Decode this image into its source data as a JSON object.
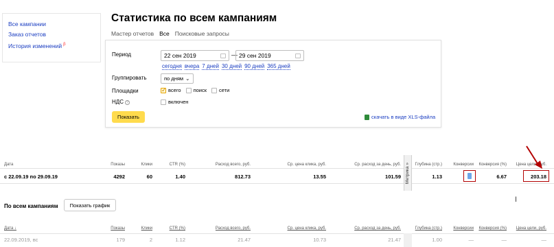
{
  "sidebar": {
    "items": [
      {
        "label": "Все кампании"
      },
      {
        "label": "Заказ отчетов"
      },
      {
        "label": "История изменений",
        "badge": "β"
      }
    ]
  },
  "page": {
    "title": "Статистика по всем кампаниям",
    "tabs": [
      {
        "label": "Мастер отчетов",
        "active": false
      },
      {
        "label": "Все",
        "active": true
      },
      {
        "label": "Поисковые запросы",
        "active": false
      }
    ]
  },
  "filters": {
    "period_label": "Период",
    "date_from": "22 сен 2019",
    "date_to": "29 сен 2019",
    "dash": "—",
    "quick": [
      "сегодня",
      "вчера",
      "7 дней",
      "30 дней",
      "90 дней",
      "365 дней"
    ],
    "group_label": "Группировать",
    "group_value": "по дням",
    "platforms_label": "Площадки",
    "platforms": [
      {
        "label": "всего",
        "checked": true
      },
      {
        "label": "поиск",
        "checked": false
      },
      {
        "label": "сети",
        "checked": false
      }
    ],
    "vat_label": "НДС",
    "vat_info": "?",
    "vat_option": "включен",
    "show_button": "Показать",
    "xls_link": "скачать в виде XLS-файла"
  },
  "summary": {
    "headers": {
      "date": "Дата",
      "shows": "Показы",
      "clicks": "Клики",
      "ctr": "CTR (%)",
      "spend": "Расход всего, руб.",
      "cpc": "Ср. цена клика, руб.",
      "daily": "Ср. расход за день, руб.",
      "metrika": "Метрика »",
      "depth": "Глубина (стр.)",
      "conversions": "Конверсии",
      "conv_rate": "Конверсия (%)",
      "goal_price": "Цена цели, руб."
    },
    "row": {
      "date": "с 22.09.19 по 29.09.19",
      "shows": "4292",
      "clicks": "60",
      "ctr": "1.40",
      "spend": "812.73",
      "cpc": "13.55",
      "daily": "101.59",
      "depth": "1.13",
      "conv_rate": "6.67",
      "goal_price": "203.18"
    }
  },
  "by_campaign": {
    "title": "По всем кампаниям",
    "chart_button": "Показать график",
    "headers": {
      "date": "Дата ↓",
      "shows": "Показы",
      "clicks": "Клики",
      "ctr": "CTR (%)",
      "spend": "Расход всего, руб.",
      "cpc": "Ср. цена клика, руб.",
      "daily": "Ср. расход за день, руб.",
      "depth": "Глубина (стр.)",
      "conversions": "Конверсии",
      "conv_rate": "Конверсия (%)",
      "goal_price": "Цена цели, руб."
    },
    "row": {
      "date": "22.09.2019, вс",
      "shows": "179",
      "clicks": "2",
      "ctr": "1.12",
      "spend": "21.47",
      "cpc": "10.73",
      "daily": "21.47",
      "depth": "1.00",
      "conversions": "—",
      "conv_rate": "—",
      "goal_price": "—"
    }
  },
  "colors": {
    "accent": "#ffdb4d",
    "link": "#1a3dc1",
    "annotation": "#b30000"
  }
}
